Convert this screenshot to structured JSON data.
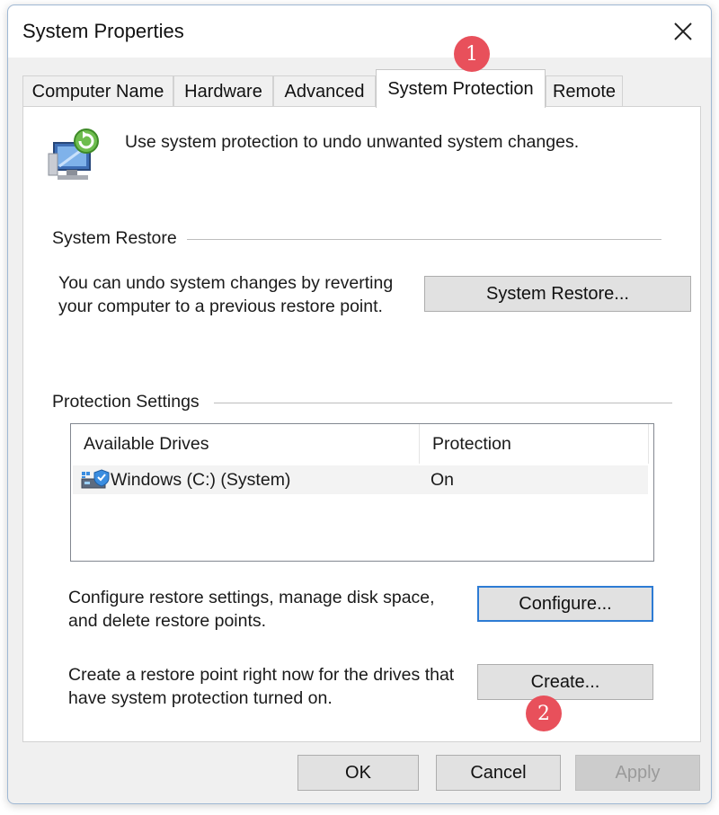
{
  "window": {
    "title": "System Properties"
  },
  "tabs": [
    {
      "label": "Computer Name"
    },
    {
      "label": "Hardware"
    },
    {
      "label": "Advanced"
    },
    {
      "label": "System Protection",
      "active": true
    },
    {
      "label": "Remote"
    }
  ],
  "intro_text": "Use system protection to undo unwanted system changes.",
  "system_restore": {
    "group_label": "System Restore",
    "line1": "You can undo system changes by reverting",
    "line2": "your computer to a previous restore point.",
    "button_label": "System Restore..."
  },
  "protection_settings": {
    "group_label": "Protection Settings",
    "columns": [
      "Available Drives",
      "Protection"
    ],
    "rows": [
      {
        "drive": "Windows (C:) (System)",
        "protection": "On"
      }
    ],
    "configure_line1": "Configure restore settings, manage disk space,",
    "configure_line2": "and delete restore points.",
    "configure_button": "Configure...",
    "create_line1": "Create a restore point right now for the drives that",
    "create_line2": "have system protection turned on.",
    "create_button": "Create..."
  },
  "footer": {
    "ok": "OK",
    "cancel": "Cancel",
    "apply": "Apply"
  },
  "callouts": [
    "1",
    "2"
  ],
  "colors": {
    "callout": "#e8505b",
    "focus_border": "#2d7bd4"
  },
  "icons": {
    "close": "close-icon",
    "system_protection": "monitor-restore-icon",
    "drive": "drive-shield-icon"
  }
}
